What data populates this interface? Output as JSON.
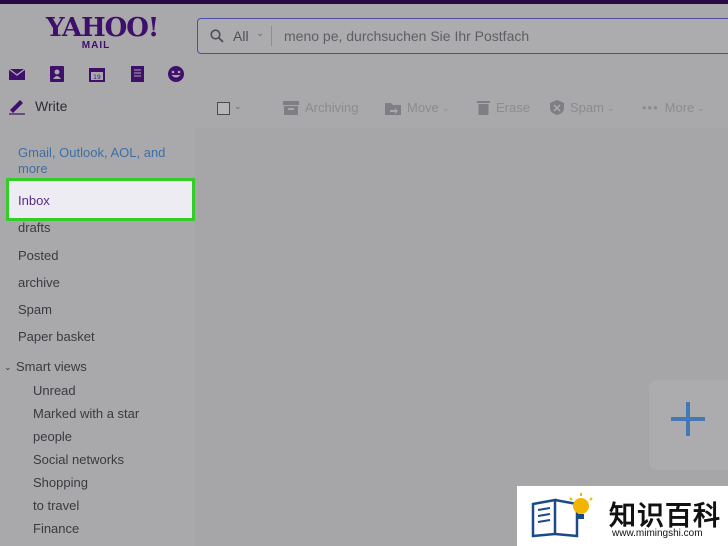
{
  "logo": {
    "main": "YAHOO!",
    "sub": "MAIL"
  },
  "search": {
    "scope": "All",
    "placeholder": "meno pe, durchsuchen Sie Ihr Postfach"
  },
  "app_icons": [
    "mail-icon",
    "contacts-icon",
    "calendar-icon",
    "notepad-icon",
    "messenger-icon"
  ],
  "compose": {
    "label": "Write"
  },
  "promo": {
    "text": "Gmail, Outlook, AOL, and more"
  },
  "folders": {
    "inbox": "Inbox",
    "drafts": "drafts",
    "posted": "Posted",
    "archive": "archive",
    "spam": "Spam",
    "trash": "Paper basket"
  },
  "smart_views": {
    "title": "Smart views",
    "items": [
      "Unread",
      "Marked with a star",
      "people",
      "Social networks",
      "Shopping",
      "to travel",
      "Finance"
    ]
  },
  "toolbar": {
    "archive": "Archiving",
    "move": "Move",
    "erase": "Erase",
    "spam": "Spam",
    "more": "More"
  },
  "watermark": {
    "title": "知识百科",
    "url": "www.mimingshi.com"
  },
  "colors": {
    "highlight_border": "#33cc28",
    "brand": "#3e0f6b",
    "link": "#3c6fa6",
    "fab_plus": "#4478b6"
  }
}
